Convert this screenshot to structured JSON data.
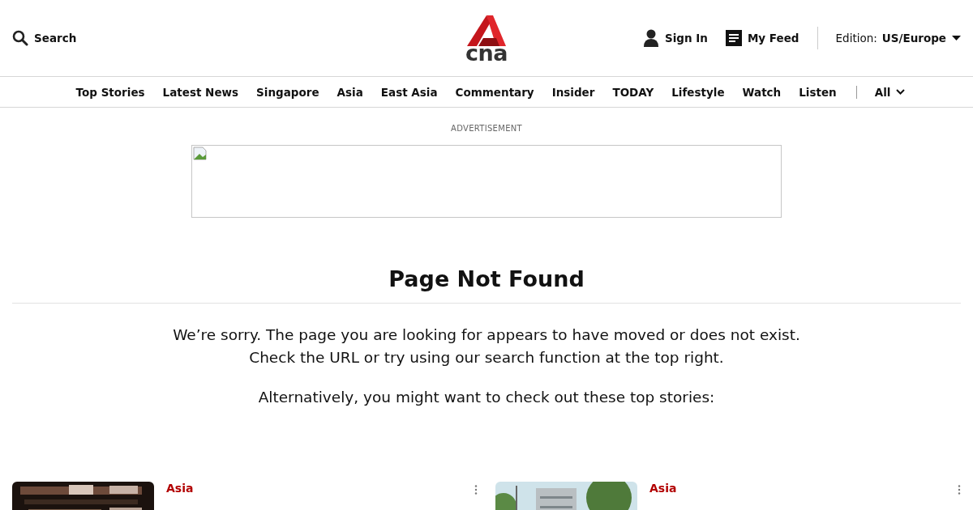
{
  "header": {
    "search_label": "Search",
    "logo_text": "cna",
    "sign_in": "Sign In",
    "my_feed": "My Feed",
    "edition_label": "Edition:",
    "edition_value": "US/Europe"
  },
  "nav": {
    "items": [
      "Top Stories",
      "Latest News",
      "Singapore",
      "Asia",
      "East Asia",
      "Commentary",
      "Insider",
      "TODAY",
      "Lifestyle",
      "Watch",
      "Listen"
    ],
    "all_label": "All"
  },
  "advertisement": {
    "label": "ADVERTISEMENT"
  },
  "title": "Page Not Found",
  "messages": [
    "We’re sorry. The page you are looking for appears to have moved or does not exist.",
    "Check the URL or try using our search function at the top right."
  ],
  "suggestion": "Alternatively, you might want to check out these top stories:",
  "stories": [
    {
      "category": "Asia"
    },
    {
      "category": "Asia"
    }
  ]
}
